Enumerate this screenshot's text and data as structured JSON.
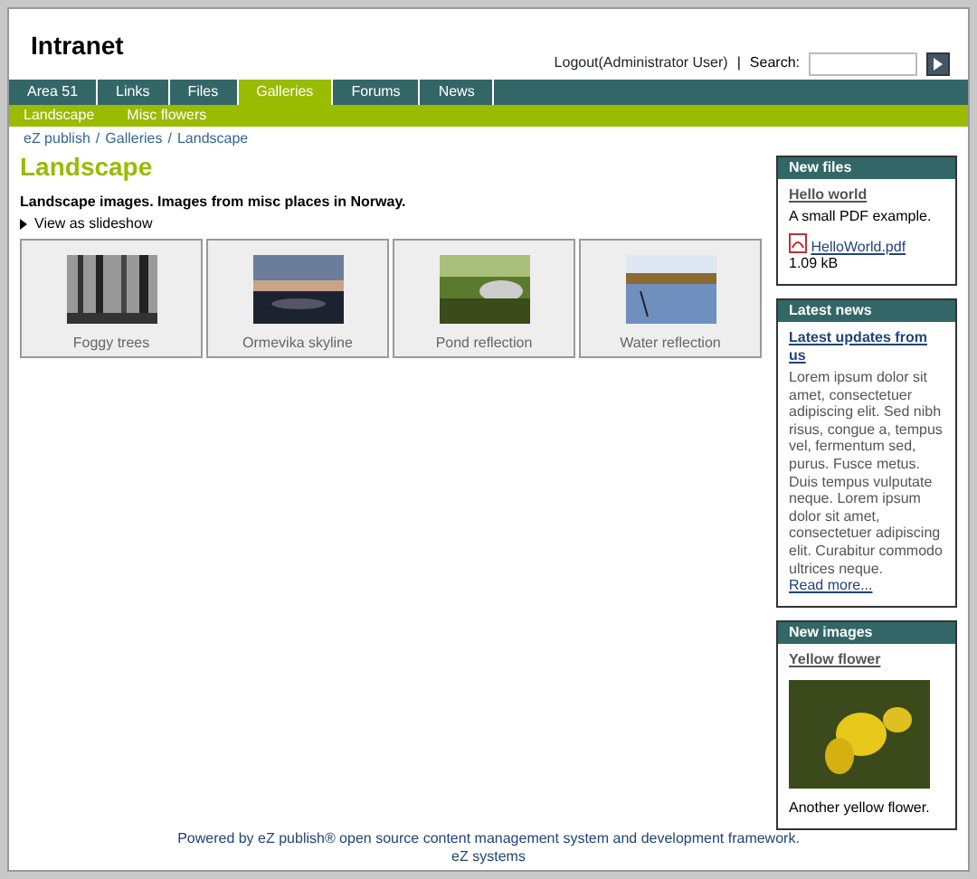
{
  "header": {
    "title": "Intranet",
    "logout": "Logout(Administrator User)",
    "separator": "|",
    "search_label": "Search:"
  },
  "tabs": [
    {
      "label": "Area 51",
      "selected": false
    },
    {
      "label": "Links",
      "selected": false
    },
    {
      "label": "Files",
      "selected": false
    },
    {
      "label": "Galleries",
      "selected": true
    },
    {
      "label": "Forums",
      "selected": false
    },
    {
      "label": "News",
      "selected": false
    }
  ],
  "subnav": [
    "Landscape",
    "Misc flowers"
  ],
  "breadcrumb": {
    "separator": "/",
    "items": [
      "eZ publish",
      "Galleries",
      "Landscape"
    ]
  },
  "page": {
    "heading": "Landscape",
    "description": "Landscape images. Images from misc places in Norway.",
    "slideshow_link": "View as slideshow"
  },
  "gallery": [
    {
      "caption": "Foggy trees"
    },
    {
      "caption": "Ormevika skyline"
    },
    {
      "caption": "Pond reflection"
    },
    {
      "caption": "Water reflection"
    }
  ],
  "sidebar": [
    {
      "title": "New files",
      "kind": "file",
      "item_title": "Hello world",
      "text": "A small PDF example.",
      "file_link": "HelloWorld.pdf",
      "file_size": "1.09 kB"
    },
    {
      "title": "Latest news",
      "kind": "news",
      "item_title": "Latest updates from us",
      "text": "Lorem ipsum dolor sit amet, consectetuer adipiscing elit. Sed nibh risus, congue a, tempus vel, fermentum sed, purus. Fusce metus. Duis tempus vulputate neque. Lorem ipsum dolor sit amet, consectetuer adipiscing elit. Curabitur commodo ultrices neque.",
      "more_link": "Read more..."
    },
    {
      "title": "New images",
      "kind": "image",
      "item_title": "Yellow flower",
      "text": "Another yellow flower."
    }
  ],
  "footer": {
    "line1": "Powered by eZ publish® open source content management system and development framework.",
    "line2": "eZ systems"
  }
}
